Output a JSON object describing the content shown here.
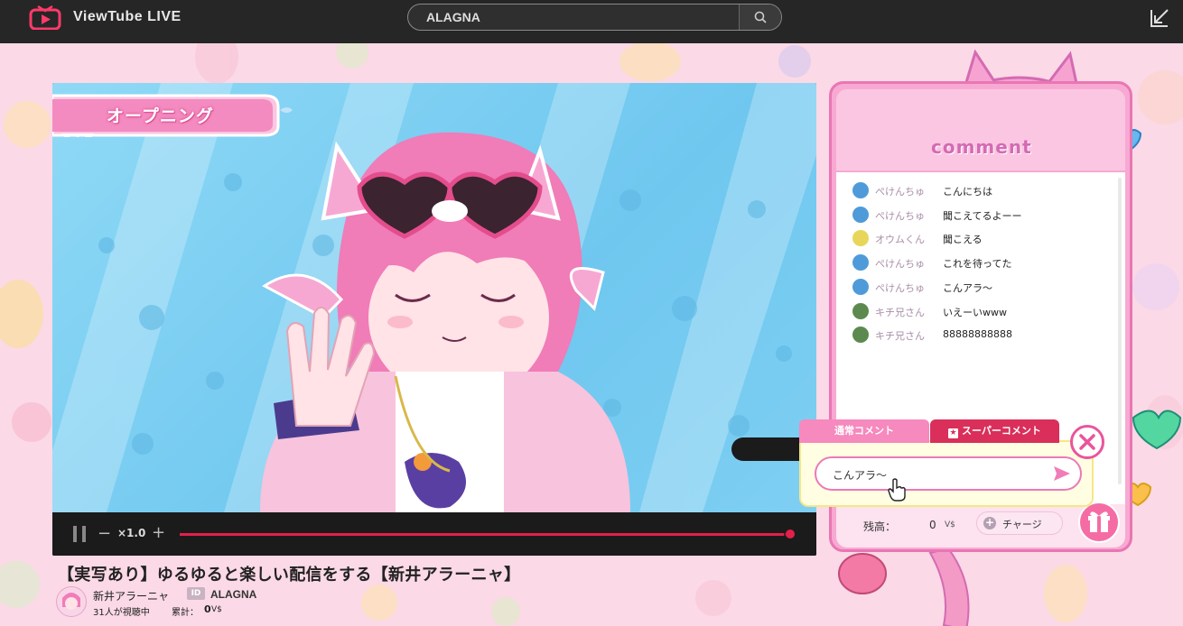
{
  "app": {
    "brand": "ViewTube  LIVE"
  },
  "search": {
    "value": "ALAGNA"
  },
  "video": {
    "overlay_label": "オープニング",
    "speed": "×1.0",
    "progress_percent": 99
  },
  "stream": {
    "title": "【実写あり】ゆるゆると楽しい配信をする【新井アラーニャ】",
    "channel_name": "新井アラーニャ",
    "id_badge": "ID",
    "id_value": "ALAGNA",
    "viewers": "31人が視聴中",
    "total_label": "累計：",
    "total_value": "0",
    "total_unit": "V$"
  },
  "comments_panel": {
    "title": "comment",
    "comments": [
      {
        "user": "ぺけんちゅ",
        "text": "こんにちは",
        "avatar": "blue"
      },
      {
        "user": "ぺけんちゅ",
        "text": "聞こえてるよーー",
        "avatar": "blue"
      },
      {
        "user": "オウムくん",
        "text": "聞こえる",
        "avatar": "yellow"
      },
      {
        "user": "ぺけんちゅ",
        "text": "これを待ってた",
        "avatar": "blue"
      },
      {
        "user": "ぺけんちゅ",
        "text": "こんアラ～",
        "avatar": "blue"
      },
      {
        "user": "キチ兄さん",
        "text": "いえーいwww",
        "avatar": "green"
      },
      {
        "user": "キチ兄さん",
        "text": "88888888888",
        "avatar": "green"
      }
    ],
    "balance_label": "残高：",
    "balance_value": "0",
    "balance_unit": "V$",
    "charge_label": "チャージ"
  },
  "comment_input": {
    "tab_normal": "通常コメント",
    "tab_super": "スーパーコメント",
    "value": "こんアラ～"
  },
  "colors": {
    "accent_pink": "#e976b3",
    "seek_red": "#e3204b",
    "super_red": "#d92f5a"
  }
}
